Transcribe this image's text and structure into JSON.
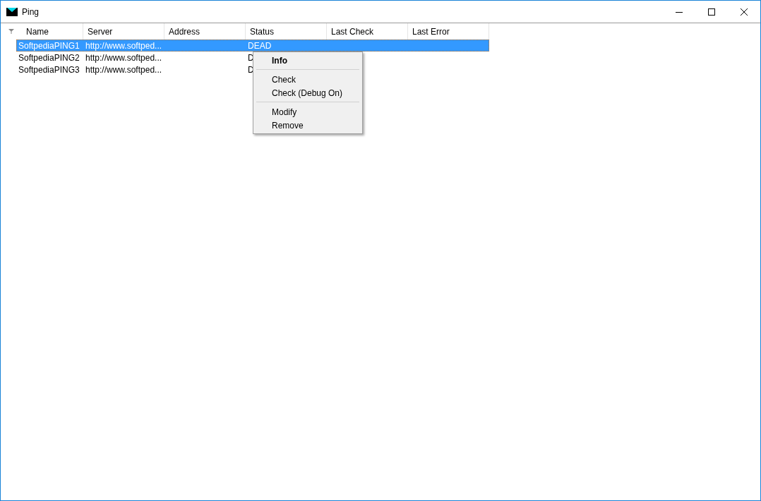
{
  "window": {
    "title": "Ping"
  },
  "table": {
    "columns": [
      "Name",
      "Server",
      "Address",
      "Status",
      "Last Check",
      "Last Error"
    ],
    "rows": [
      {
        "selected": true,
        "cells": [
          "SoftpediaPING1",
          "http://www.softped...",
          "",
          "DEAD",
          "",
          ""
        ]
      },
      {
        "selected": false,
        "cells": [
          "SoftpediaPING2",
          "http://www.softped...",
          "",
          "D",
          "",
          ""
        ]
      },
      {
        "selected": false,
        "cells": [
          "SoftpediaPING3",
          "http://www.softped...",
          "",
          "D",
          "",
          ""
        ]
      }
    ]
  },
  "context_menu": {
    "items": [
      {
        "kind": "item",
        "label": "Info",
        "bold": true
      },
      {
        "kind": "separator"
      },
      {
        "kind": "item",
        "label": "Check",
        "bold": false
      },
      {
        "kind": "item",
        "label": "Check (Debug On)",
        "bold": false
      },
      {
        "kind": "separator"
      },
      {
        "kind": "item",
        "label": "Modify",
        "bold": false
      },
      {
        "kind": "item",
        "label": "Remove",
        "bold": false
      }
    ]
  }
}
